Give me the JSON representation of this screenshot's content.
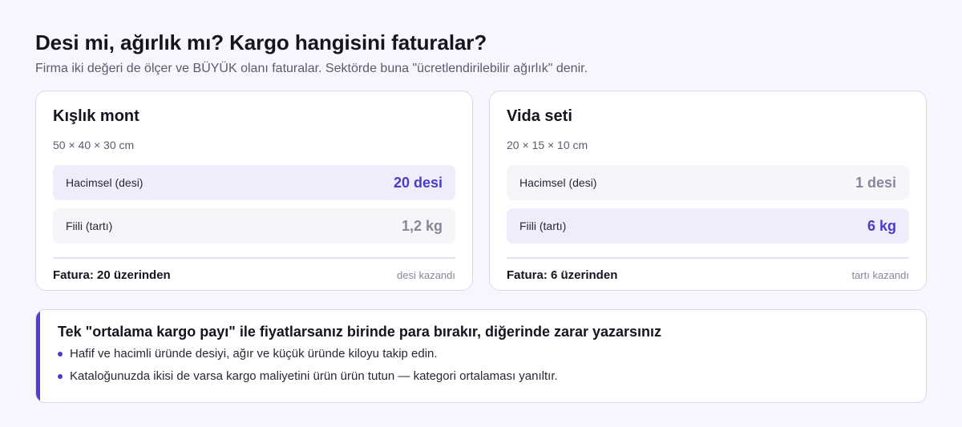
{
  "header": {
    "title": "Desi mi, ağırlık mı? Kargo hangisini faturalar?",
    "subtitle": "Firma iki değeri de ölçer ve BÜYÜK olanı faturalar. Sektörde buna \"ücretlendirilebilir ağırlık\" denir."
  },
  "cards": [
    {
      "title": "Kışlık mont",
      "dims": "50 × 40 × 30 cm",
      "volumetric_label": "Hacimsel (desi)",
      "volumetric_value": "20 desi",
      "actual_label": "Fiili (tartı)",
      "actual_value": "1,2 kg",
      "footer": "Fatura: 20 üzerinden",
      "winner_note": "desi kazandı"
    },
    {
      "title": "Vida seti",
      "dims": "20 × 15 × 10 cm",
      "volumetric_label": "Hacimsel (desi)",
      "volumetric_value": "1 desi",
      "actual_label": "Fiili (tartı)",
      "actual_value": "6 kg",
      "footer": "Fatura: 6 üzerinden",
      "winner_note": "tartı kazandı"
    }
  ],
  "callout": {
    "title": "Tek \"ortalama kargo payı\" ile fiyatlarsanız birinde para bırakır, diğerinde zarar yazarsınız",
    "bullets": [
      "Hafif ve hacimli üründe desiyi, ağır ve küçük üründe kiloyu takip edin.",
      "Kataloğunuzda ikisi de varsa kargo maliyetini ürün ürün tutun — kategori ortalaması yanıltır."
    ]
  },
  "colors": {
    "accent": "#4b3cc4",
    "win_row_bg": "#efecfc",
    "muted_value": "#8a8699"
  }
}
